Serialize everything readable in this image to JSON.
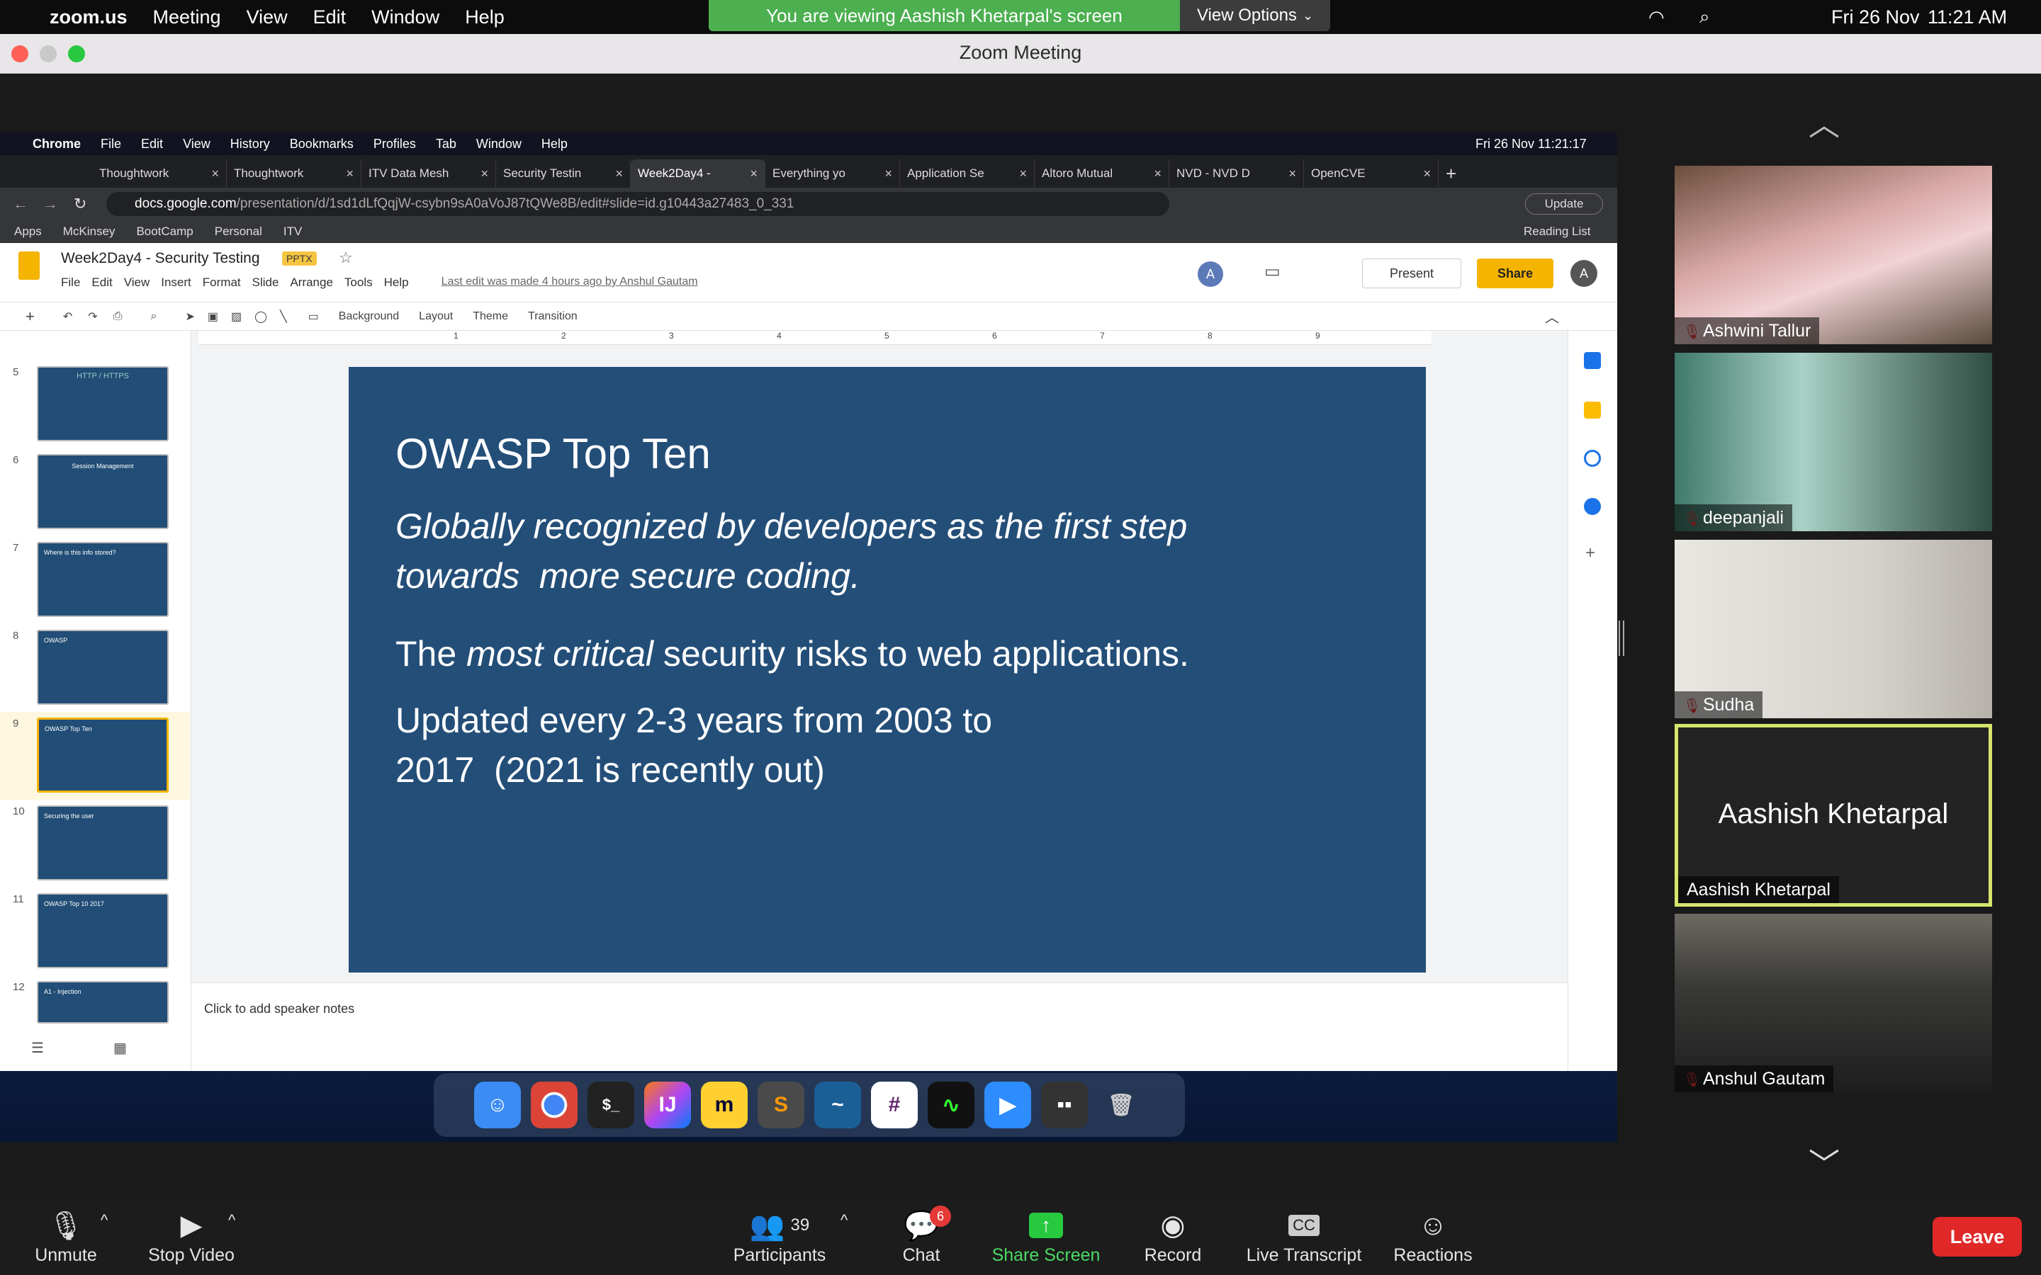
{
  "mac_menu": {
    "app": "zoom.us",
    "items": [
      "Meeting",
      "View",
      "Edit",
      "Window",
      "Help"
    ],
    "date": "Fri 26 Nov",
    "time": "11:21 AM"
  },
  "notice": {
    "text": "You are viewing Aashish Khetarpal's screen",
    "view_options": "View Options"
  },
  "window": {
    "title": "Zoom Meeting"
  },
  "chrome": {
    "menu": [
      "Chrome",
      "File",
      "Edit",
      "View",
      "History",
      "Bookmarks",
      "Profiles",
      "Tab",
      "Window",
      "Help"
    ],
    "datetime": "Fri 26 Nov  11:21:17",
    "tabs": [
      "Thoughtwork",
      "Thoughtwork",
      "ITV Data Mesh",
      "Security Testin",
      "Week2Day4 -",
      "Everything yo",
      "Application Se",
      "Altoro Mutual",
      "NVD - NVD D",
      "OpenCVE"
    ],
    "url_host": "docs.google.com",
    "url_path": "/presentation/d/1sd1dLfQqjW-csybn9sA0aVoJ87tQWe8B/edit#slide=id.g10443a27483_0_331",
    "update": "Update",
    "bookmarks": [
      "Apps",
      "McKinsey",
      "BootCamp",
      "Personal",
      "ITV"
    ],
    "reading_list": "Reading List"
  },
  "slides": {
    "doc_title": "Week2Day4 - Security Testing",
    "badge": "PPTX",
    "menu": [
      "File",
      "Edit",
      "View",
      "Insert",
      "Format",
      "Slide",
      "Arrange",
      "Tools",
      "Help"
    ],
    "last_edit": "Last edit was made 4 hours ago by Anshul Gautam",
    "present": "Present",
    "share": "Share",
    "avatar": "A",
    "toolbar": [
      "Background",
      "Layout",
      "Theme",
      "Transition"
    ],
    "thumb_nums": [
      "5",
      "6",
      "7",
      "8",
      "9",
      "10",
      "11",
      "12"
    ],
    "thumb_texts": [
      "HTTP / HTTPS",
      "Session Management",
      "Where is this info stored?",
      "OWASP",
      "OWASP Top Ten",
      "Securing the user",
      "OWASP Top 10 2017",
      "A1 - Injection"
    ],
    "ruler": [
      "1",
      "2",
      "3",
      "4",
      "5",
      "6",
      "7",
      "8",
      "9"
    ],
    "notes_placeholder": "Click to add speaker notes"
  },
  "slide": {
    "title": "OWASP Top Ten",
    "italic_line1": "Globally recognized by developers as the first step",
    "italic_line2": "towards  more secure coding.",
    "l2_pre": "The ",
    "l2_em": "most critical",
    "l2_post": " security risks to web applications.",
    "l3_line1": "Updated every 2-3 years from 2003 to",
    "l3_line2": "2017  (2021 is recently out)"
  },
  "participants": [
    {
      "name": "Ashwini Tallur"
    },
    {
      "name": "deepanjali"
    },
    {
      "name": "Sudha"
    },
    {
      "name": "Aashish Khetarpal",
      "center": "Aashish Khetarpal"
    },
    {
      "name": "Anshul Gautam"
    }
  ],
  "controls": {
    "unmute": "Unmute",
    "stop_video": "Stop Video",
    "participants": "Participants",
    "participant_count": "39",
    "chat": "Chat",
    "chat_badge": "6",
    "share_screen": "Share Screen",
    "record": "Record",
    "live_transcript": "Live Transcript",
    "reactions": "Reactions",
    "leave": "Leave",
    "cc": "CC"
  }
}
